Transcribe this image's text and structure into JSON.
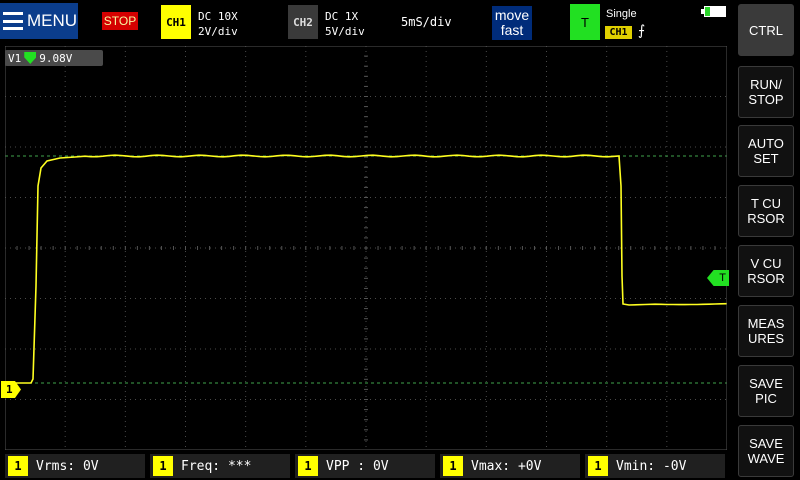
{
  "menu": {
    "label": "MENU",
    "icon": "hamburger-menu-icon"
  },
  "status": {
    "run_state": "STOP"
  },
  "ch1": {
    "label": "CH1",
    "coupling": "DC  10X",
    "scale": "2V/div",
    "color": "#ffff00"
  },
  "ch2": {
    "label": "CH2",
    "coupling": "DC  1X",
    "scale": "5V/div"
  },
  "timebase": "5mS/div",
  "move": {
    "line1": "move",
    "line2": "fast"
  },
  "trigger": {
    "label": "T",
    "mode": "Single",
    "source": "CH1",
    "edge": "⨍",
    "edge_icon": "rising-edge-icon",
    "color": "#22e022"
  },
  "battery": {
    "level": 0.25
  },
  "cursor": {
    "readout": "9.08V",
    "label": "V1"
  },
  "markers": {
    "ch1": "1",
    "trigger": "T"
  },
  "side_buttons": [
    {
      "label": "CTRL"
    },
    {
      "label": "RUN/\nSTOP"
    },
    {
      "label": "AUTO\nSET"
    },
    {
      "label": "T CU\nRSOR"
    },
    {
      "label": "V CU\nRSOR"
    },
    {
      "label": "MEAS\nURES"
    },
    {
      "label": "SAVE\nPIC"
    },
    {
      "label": "SAVE\nWAVE"
    }
  ],
  "measurements": [
    {
      "channel": "1",
      "text": "Vrms: 0V"
    },
    {
      "channel": "1",
      "text": "Freq: ***"
    },
    {
      "channel": "1",
      "text": "VPP : 0V"
    },
    {
      "channel": "1",
      "text": "Vmax: +0V"
    },
    {
      "channel": "1",
      "text": "Vmin: -0V"
    }
  ]
}
